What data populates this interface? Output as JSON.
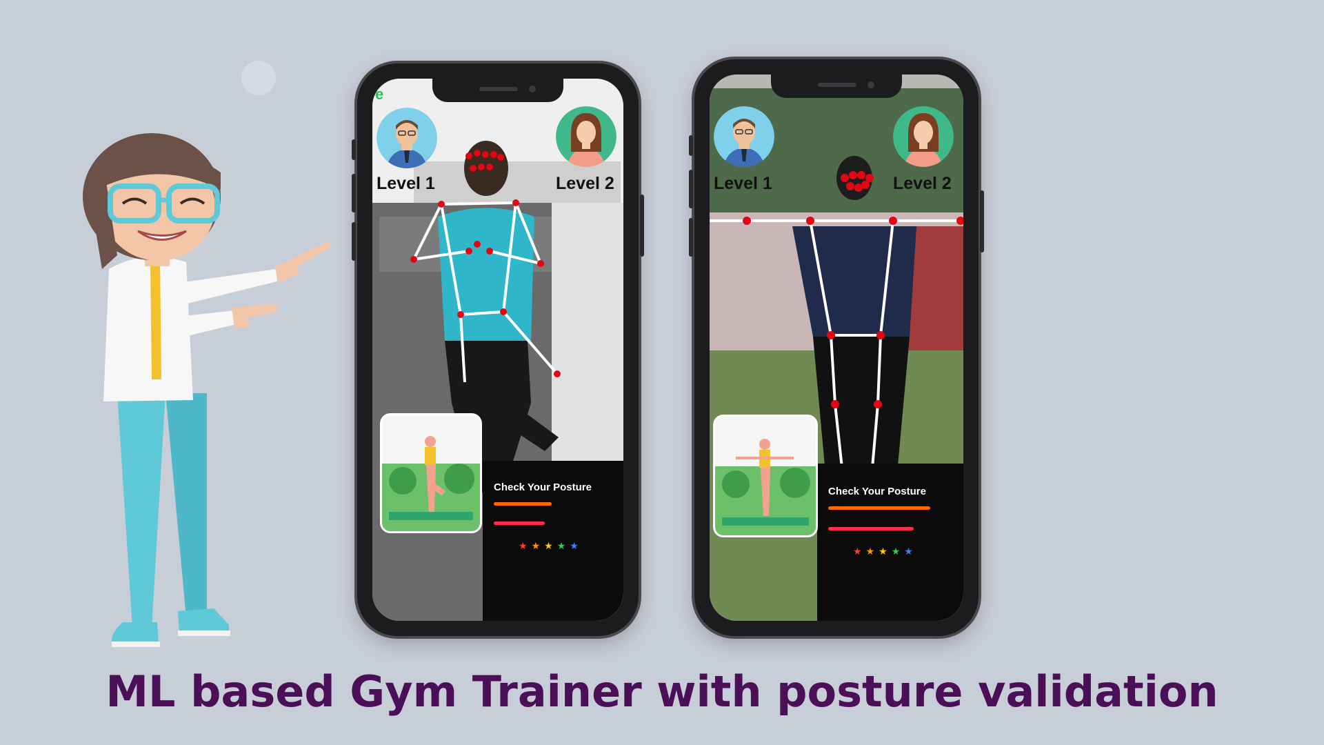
{
  "headline": "ML based Gym Trainer with posture validation",
  "phones": [
    {
      "level1_label": "Level 1",
      "level2_label": "Level 2",
      "corner_mark": "e",
      "posture_label": "Check Your Posture",
      "stars": "★★★★★",
      "pose": "tree-pose"
    },
    {
      "level1_label": "Level 1",
      "level2_label": "Level 2",
      "posture_label": "Check Your Posture",
      "stars": "★★★★★",
      "pose": "t-pose"
    }
  ],
  "colors": {
    "background": "#c8ced8",
    "headline": "#4b0f57",
    "skeleton_line": "#ffffff",
    "skeleton_joint": "#e30613",
    "bar_orange": "#ff6a00",
    "bar_red": "#ff2d4a",
    "accent_green": "#22c55e"
  },
  "icons": [
    "male-avatar-icon",
    "female-avatar-icon",
    "star-icon",
    "yoga-thumbnail"
  ]
}
